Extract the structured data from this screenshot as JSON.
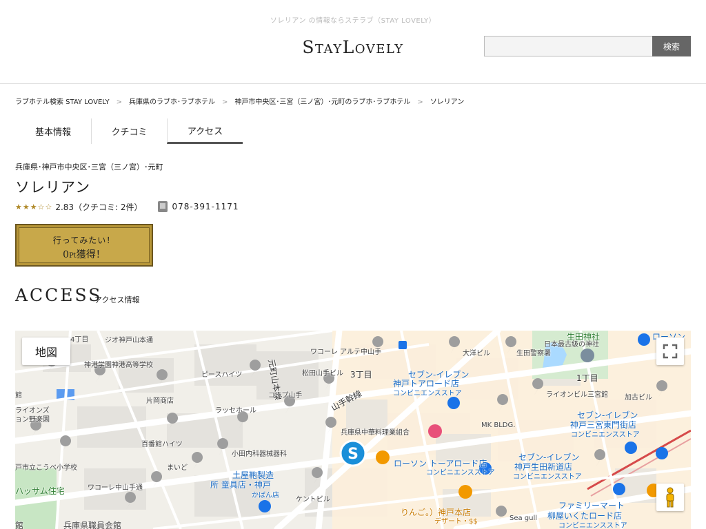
{
  "header": {
    "tagline": "ソレリアン の情報ならステラブ（STAY LOVELY）",
    "logo": "StayLovely",
    "search_placeholder": "",
    "search_button": "検索"
  },
  "breadcrumb": [
    "ラブホテル検索 STAY LOVELY",
    "兵庫県のラブホ･ラブホテル",
    "神戸市中央区･三宮（三ノ宮）･元町のラブホ･ラブホテル",
    "ソレリアン"
  ],
  "breadcrumb_separator": ">",
  "tabs": [
    {
      "label": "基本情報",
      "active": false
    },
    {
      "label": "クチコミ",
      "active": false
    },
    {
      "label": "アクセス",
      "active": true
    }
  ],
  "hotel": {
    "area": "兵庫県･神戸市中央区･三宮（三ノ宮）･元町",
    "name": "ソレリアン",
    "stars_display": "★★★☆☆",
    "rating_value": 2.83,
    "rating_text": "2.83（クチコミ: 2件）",
    "phone": "078-391-1171"
  },
  "want_button": {
    "line1": "行ってみたい！",
    "points": "0",
    "points_unit": "Pt",
    "line2_suffix": "獲得！"
  },
  "access": {
    "heading": "ACCESS",
    "subheading": "アクセス情報"
  },
  "map": {
    "type_button": "地図",
    "labels": {
      "l1": "4丁目",
      "l2": "ジオ神戸山本通",
      "l3": "神港学園神港高等学校",
      "l4": "ピースハイツ",
      "l5": "片岡商店",
      "l6": "ライオンズ",
      "l7": "ョン野楽園",
      "l8": "ラッセホール",
      "l9": "百番館ハイツ",
      "l10": "戸市立こうべ小学校",
      "l11": "まいど",
      "l12": "ワコーレ中山手通",
      "l13": "ハッサム住宅",
      "l14": "兵庫県職員会館",
      "l15": "館",
      "l16": "元町山本線",
      "l17": "松田山手ビル",
      "l18": "コープ山手",
      "l19": "小田内科器械器科",
      "l20": "土屋鞄製造",
      "l21": "所 童具店・神戸",
      "l22": "かばん店",
      "l23": "ケントビル",
      "l24": "ワコーレ アルテ中山手",
      "l25": "3丁目",
      "l26": "山手幹線",
      "l27": "兵庫県中華料理業組合",
      "l28": "セブン-イレブン",
      "l29": "神戸トアロード店",
      "l30": "コンビニエンスストア",
      "l31": "大洋ビル",
      "l32": "生田警察署",
      "l33": "生田神社",
      "l34": "日本最古級の神社",
      "l35": "1丁目",
      "l36": "ライオンビル三宮館",
      "l37": "加古ビル",
      "l38": "MK BLDG.",
      "l39": "セブン-イレブン",
      "l40": "神戸三宮東門街店",
      "l41": "コンビニエンスストア",
      "l42": "ローソン トーアロード店",
      "l43": "コンビニエンスストア",
      "l44": "セブン-イレブン",
      "l45": "神戸生田新道店",
      "l46": "コンビニエンスストア",
      "l47": "ファミリーマート",
      "l48": "柳屋いくたロード店",
      "l49": "コンビニエンスストア",
      "l50": "りんご。）神戸本店",
      "l51": "デザート・$$",
      "l52": "Sea gull",
      "l53": "ローソン",
      "l54": "ワコーレ",
      "l55": "S"
    }
  },
  "colors": {
    "gold": "#c8a84a",
    "accent_blue": "#1a6bc4",
    "map_bg": "#f2efe9"
  }
}
